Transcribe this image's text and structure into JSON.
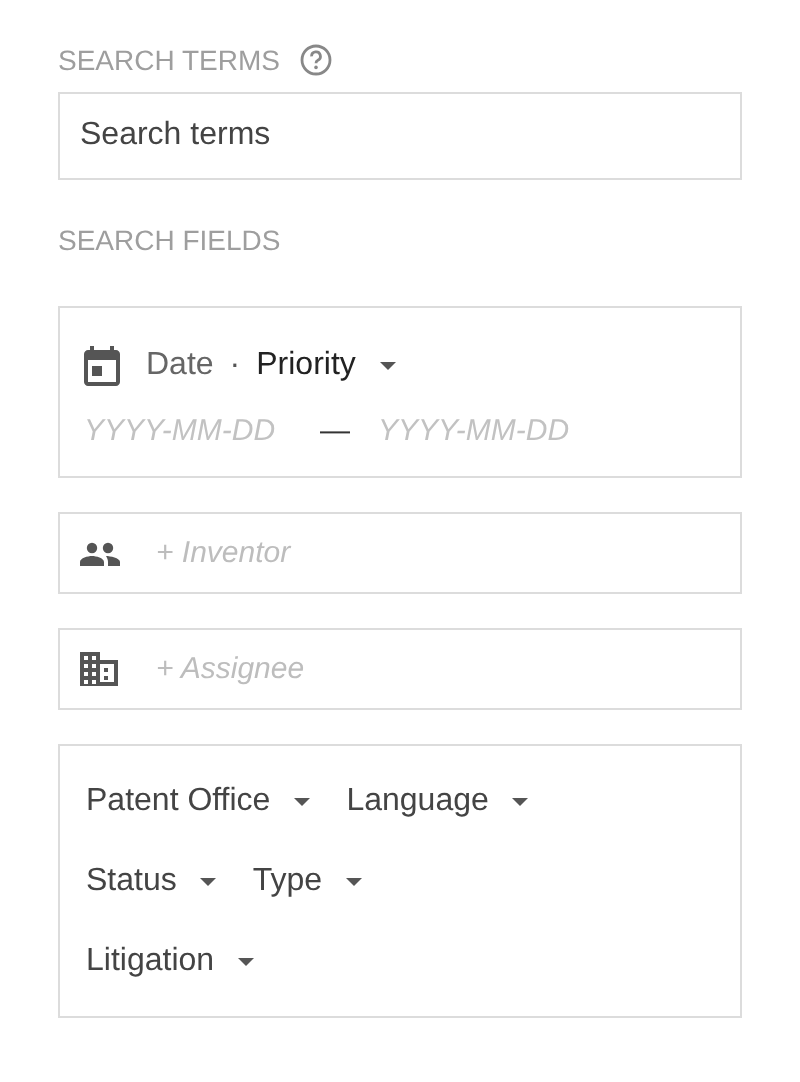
{
  "search_terms": {
    "heading": "SEARCH TERMS",
    "placeholder": "Search terms"
  },
  "search_fields": {
    "heading": "SEARCH FIELDS"
  },
  "date": {
    "types": [
      {
        "label": "Date",
        "selected": false
      },
      {
        "label": "Priority",
        "selected": true
      }
    ],
    "separator": "·",
    "from_placeholder": "YYYY-MM-DD",
    "dash": "—",
    "to_placeholder": "YYYY-MM-DD"
  },
  "people_fields": [
    {
      "kind": "inventor",
      "placeholder": "+ Inventor"
    },
    {
      "kind": "assignee",
      "placeholder": "+ Assignee"
    }
  ],
  "filter_rows": [
    [
      "Patent Office",
      "Language"
    ],
    [
      "Status",
      "Type"
    ],
    [
      "Litigation"
    ]
  ]
}
